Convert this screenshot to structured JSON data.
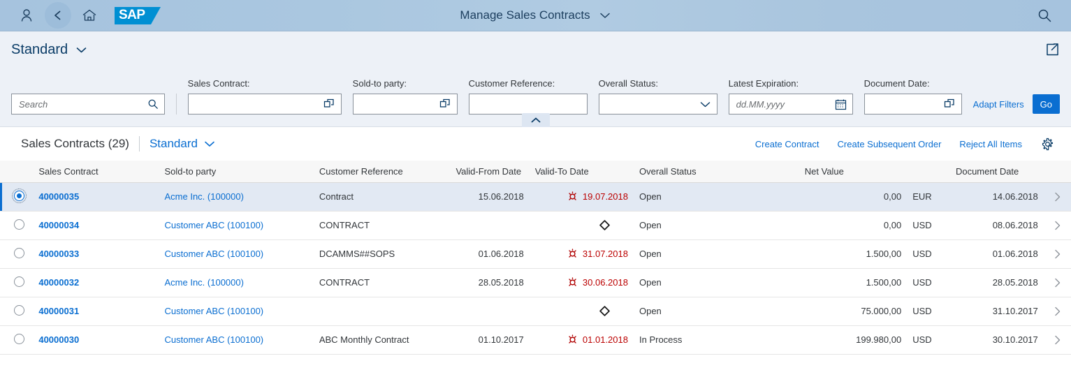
{
  "shell": {
    "user_icon": "person-icon",
    "back_icon": "back-chevron-icon",
    "home_icon": "home-icon",
    "logo_text": "SAP",
    "title": "Manage Sales Contracts",
    "title_dropdown_icon": "chevron-down-icon",
    "search_icon": "search-icon"
  },
  "variant_bar": {
    "title": "Standard",
    "dropdown_icon": "chevron-down-icon",
    "share_icon": "share-export-icon"
  },
  "filters": {
    "search": {
      "name": "search-input",
      "value": "",
      "placeholder": "Search",
      "icon": "search-icon"
    },
    "fields": [
      {
        "label": "Sales Contract:",
        "value": "",
        "placeholder": "",
        "type": "valuehelp",
        "icon": "value-help-icon"
      },
      {
        "label": "Sold-to party:",
        "value": "",
        "placeholder": "",
        "type": "valuehelp",
        "icon": "value-help-icon"
      },
      {
        "label": "Customer Reference:",
        "value": "",
        "placeholder": "",
        "type": "text",
        "icon": ""
      },
      {
        "label": "Overall Status:",
        "value": "",
        "placeholder": "",
        "type": "select",
        "icon": "chevron-down-icon"
      },
      {
        "label": "Latest Expiration:",
        "value": "",
        "placeholder": "dd.MM.yyyy",
        "type": "date",
        "icon": "calendar-icon"
      },
      {
        "label": "Document Date:",
        "value": "",
        "placeholder": "",
        "type": "valuehelp",
        "icon": "value-help-icon"
      }
    ],
    "adapt_filters_label": "Adapt Filters",
    "go_label": "Go",
    "collapse_icon": "chevron-up-icon"
  },
  "table": {
    "title": "Sales Contracts (29)",
    "variant": "Standard",
    "variant_dropdown_icon": "chevron-down-icon",
    "actions": [
      {
        "label": "Create Contract",
        "name": "create-contract-button"
      },
      {
        "label": "Create Subsequent Order",
        "name": "create-subsequent-order-button"
      },
      {
        "label": "Reject All Items",
        "name": "reject-all-items-button"
      }
    ],
    "settings_icon": "gear-icon",
    "columns": [
      "Sales Contract",
      "Sold-to party",
      "Customer Reference",
      "Valid-From Date",
      "Valid-To Date",
      "Overall Status",
      "Net Value",
      "Document Date"
    ],
    "rows": [
      {
        "selected": true,
        "sales_contract": "40000035",
        "sold_to_party": "Acme Inc. (100000)",
        "customer_reference": "Contract",
        "valid_from": "15.06.2018",
        "valid_to": "19.07.2018",
        "valid_to_icon": "alert-overdue-icon",
        "valid_to_alert": true,
        "overall_status": "Open",
        "net_value": "0,00",
        "currency": "EUR",
        "document_date": "14.06.2018",
        "nav_icon": "chevron-right-icon"
      },
      {
        "selected": false,
        "sales_contract": "40000034",
        "sold_to_party": "Customer ABC (100100)",
        "customer_reference": "CONTRACT",
        "valid_from": "",
        "valid_to": "",
        "valid_to_icon": "diamond-outline-icon",
        "valid_to_alert": false,
        "overall_status": "Open",
        "net_value": "0,00",
        "currency": "USD",
        "document_date": "08.06.2018",
        "nav_icon": "chevron-right-icon"
      },
      {
        "selected": false,
        "sales_contract": "40000033",
        "sold_to_party": "Customer ABC (100100)",
        "customer_reference": "DCAMMS##SOPS",
        "valid_from": "01.06.2018",
        "valid_to": "31.07.2018",
        "valid_to_icon": "alert-overdue-icon",
        "valid_to_alert": true,
        "overall_status": "Open",
        "net_value": "1.500,00",
        "currency": "USD",
        "document_date": "01.06.2018",
        "nav_icon": "chevron-right-icon"
      },
      {
        "selected": false,
        "sales_contract": "40000032",
        "sold_to_party": "Acme Inc. (100000)",
        "customer_reference": "CONTRACT",
        "valid_from": "28.05.2018",
        "valid_to": "30.06.2018",
        "valid_to_icon": "alert-overdue-icon",
        "valid_to_alert": true,
        "overall_status": "Open",
        "net_value": "1.500,00",
        "currency": "USD",
        "document_date": "28.05.2018",
        "nav_icon": "chevron-right-icon"
      },
      {
        "selected": false,
        "sales_contract": "40000031",
        "sold_to_party": "Customer ABC (100100)",
        "customer_reference": "",
        "valid_from": "",
        "valid_to": "",
        "valid_to_icon": "diamond-outline-icon",
        "valid_to_alert": false,
        "overall_status": "Open",
        "net_value": "75.000,00",
        "currency": "USD",
        "document_date": "31.10.2017",
        "nav_icon": "chevron-right-icon"
      },
      {
        "selected": false,
        "sales_contract": "40000030",
        "sold_to_party": "Customer ABC (100100)",
        "customer_reference": "ABC Monthly Contract",
        "valid_from": "01.10.2017",
        "valid_to": "01.01.2018",
        "valid_to_icon": "alert-overdue-icon",
        "valid_to_alert": true,
        "overall_status": "In Process",
        "net_value": "199.980,00",
        "currency": "USD",
        "document_date": "30.10.2017",
        "nav_icon": "chevron-right-icon"
      }
    ]
  },
  "colors": {
    "accent": "#0a6ed1",
    "shell_bg": "#a6c3de",
    "alert_red": "#b00",
    "sap_blue": "#008fd3",
    "selected_row": "#e2e9f3"
  }
}
